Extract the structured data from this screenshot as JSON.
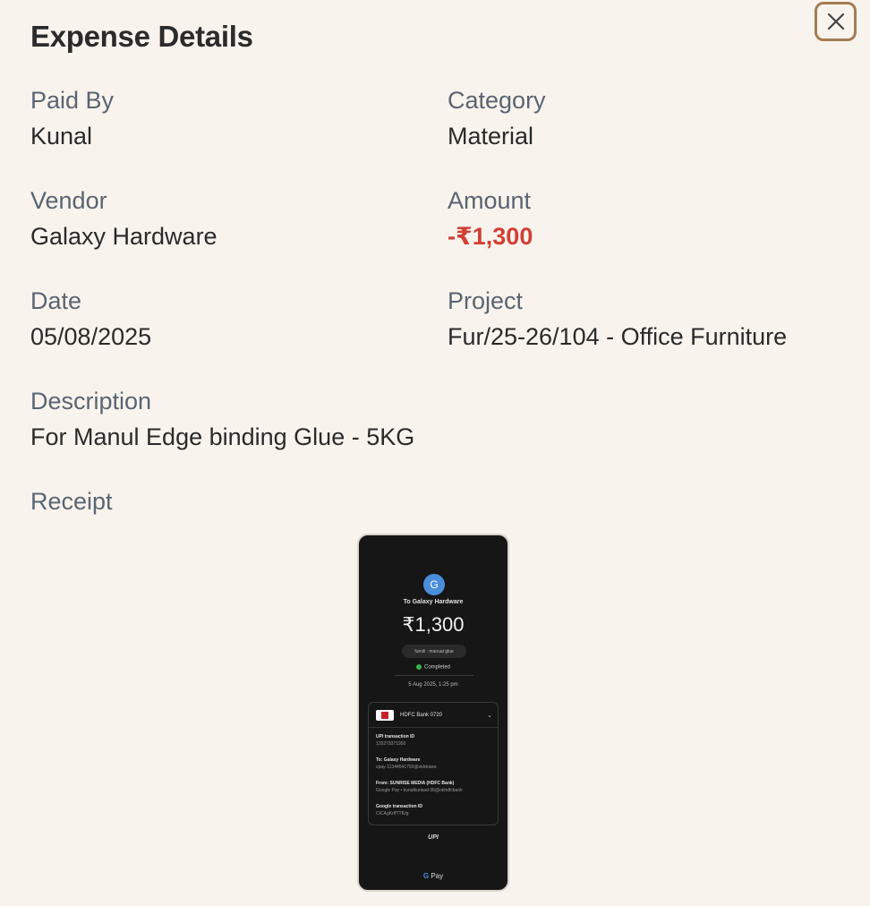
{
  "modal": {
    "title": "Expense Details",
    "close_icon": "close-icon"
  },
  "fields": {
    "paid_by": {
      "label": "Paid By",
      "value": "Kunal"
    },
    "category": {
      "label": "Category",
      "value": "Material"
    },
    "vendor": {
      "label": "Vendor",
      "value": "Galaxy Hardware"
    },
    "amount": {
      "label": "Amount",
      "value": "-₹1,300",
      "color": "#d23f35"
    },
    "date": {
      "label": "Date",
      "value": "05/08/2025"
    },
    "project": {
      "label": "Project",
      "value": "Fur/25-26/104 - Office Furniture"
    },
    "description": {
      "label": "Description",
      "value": "For Manul Edge binding Glue - 5KG"
    },
    "receipt": {
      "label": "Receipt"
    }
  },
  "receipt_image": {
    "avatar": "G",
    "to": "To Galaxy Hardware",
    "amount": "₹1,300",
    "note": "furnili : manual glue",
    "status": "Completed",
    "datetime": "5 Aug 2025, 1:25 pm",
    "bank": "HDFC Bank 0720",
    "rows": [
      {
        "key": "UPI transaction ID",
        "value": "129279371950"
      },
      {
        "key": "To: Galaxy Hardware",
        "value": "cpay-11344541793@okbtraws"
      },
      {
        "key": "From: SUNRISE MEDIA (HDFC Bank)",
        "value": "Google Pay • kunalkunkad-36@okhdfcbank"
      },
      {
        "key": "Google transaction ID",
        "value": "CICAgKrIfTTfUg"
      }
    ],
    "upi_logo": "UPI",
    "footer_g": "G",
    "footer": "Pay"
  },
  "colors": {
    "background": "#f8f4ed",
    "close_border": "#a57c55",
    "label": "#5b6472",
    "amount_negative": "#d23f35"
  }
}
